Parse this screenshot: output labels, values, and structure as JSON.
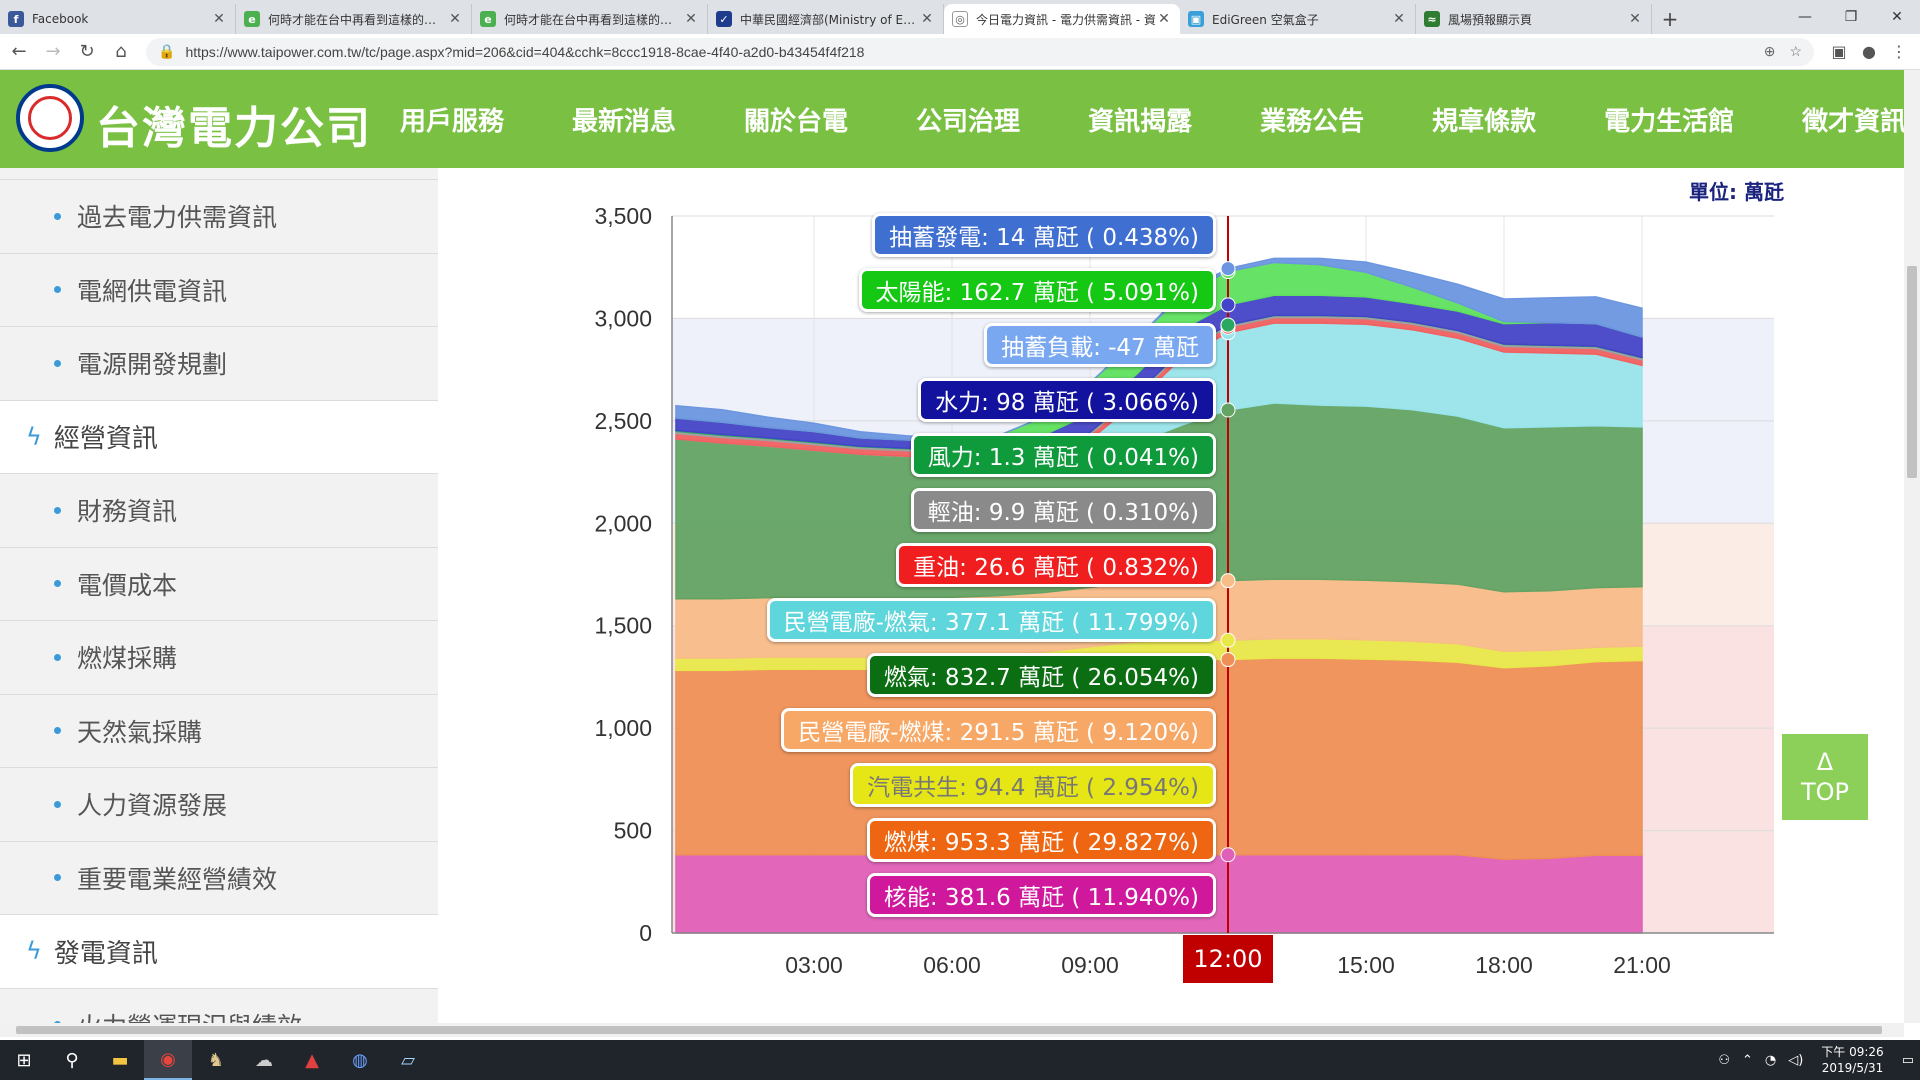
{
  "browser": {
    "tabs": [
      {
        "title": "Facebook",
        "favicon": "facebook-icon",
        "color": "#3b5998",
        "glyph": "f"
      },
      {
        "title": "何時才能在台中再看到這樣的藍天",
        "favicon": "edigreen-icon",
        "color": "#4caf50",
        "glyph": "e"
      },
      {
        "title": "何時才能在台中再看到這樣的藍天",
        "favicon": "edigreen-icon",
        "color": "#4caf50",
        "glyph": "e"
      },
      {
        "title": "中華民國經濟部(Ministry of Econ",
        "favicon": "moea-icon",
        "color": "#1e3c8c",
        "glyph": "✓"
      },
      {
        "title": "今日電力資訊 - 電力供需資訊 - 資",
        "favicon": "taipower-icon",
        "color": "#ffffff",
        "glyph": "◎",
        "active": true
      },
      {
        "title": "EdiGreen 空氣盒子",
        "favicon": "edigreen-air-icon",
        "color": "#3aa0d8",
        "glyph": "▣"
      },
      {
        "title": "風場預報顯示頁",
        "favicon": "wind-icon",
        "color": "#2e7d32",
        "glyph": "≈"
      }
    ],
    "url": "https://www.taipower.com.tw/tc/page.aspx?mid=206&cid=404&cchk=8ccc1918-8cae-4f40-a2d0-b43454f4f218"
  },
  "site": {
    "brand": "台灣電力公司",
    "nav": [
      "用戶服務",
      "最新消息",
      "關於台電",
      "公司治理",
      "資訊揭露",
      "業務公告",
      "規章條款",
      "電力生活館",
      "徵才資訊"
    ]
  },
  "sidebar": {
    "items": [
      {
        "label": "過去電力供需資訊",
        "type": "sub"
      },
      {
        "label": "電網供電資訊",
        "type": "sub"
      },
      {
        "label": "電源開發規劃",
        "type": "sub"
      },
      {
        "label": "經營資訊",
        "type": "cat"
      },
      {
        "label": "財務資訊",
        "type": "sub"
      },
      {
        "label": "電價成本",
        "type": "sub"
      },
      {
        "label": "燃煤採購",
        "type": "sub"
      },
      {
        "label": "天然氣採購",
        "type": "sub"
      },
      {
        "label": "人力資源發展",
        "type": "sub"
      },
      {
        "label": "重要電業經營績效",
        "type": "sub"
      },
      {
        "label": "發電資訊",
        "type": "cat"
      },
      {
        "label": "火力營運現況與績效",
        "type": "sub"
      }
    ]
  },
  "chart_unit": "單位: 萬瓩",
  "time_badge": "12:00",
  "top_button": {
    "arrow": "Δ",
    "label": "TOP"
  },
  "callouts": [
    {
      "text": "抽蓄發電: 14 萬瓩 ( 0.438%)",
      "color": "#3f6fd0"
    },
    {
      "text": "太陽能: 162.7 萬瓩 ( 5.091%)",
      "color": "#14c814"
    },
    {
      "text": "抽蓄負載: -47 萬瓩",
      "color": "#7aa8f0"
    },
    {
      "text": "水力: 98 萬瓩 ( 3.066%)",
      "color": "#12129e"
    },
    {
      "text": "風力: 1.3 萬瓩 ( 0.041%)",
      "color": "#0f9a3c"
    },
    {
      "text": "輕油: 9.9 萬瓩 ( 0.310%)",
      "color": "#8a8a8a"
    },
    {
      "text": "重油: 26.6 萬瓩 ( 0.832%)",
      "color": "#f01e1e"
    },
    {
      "text": "民營電廠-燃氣: 377.1 萬瓩 ( 11.799%)",
      "color": "#5fd6dc"
    },
    {
      "text": "燃氣: 832.7 萬瓩 ( 26.054%)",
      "color": "#0b6e12"
    },
    {
      "text": "民營電廠-燃煤: 291.5 萬瓩 ( 9.120%)",
      "color": "#f7a866"
    },
    {
      "text": "汽電共生: 94.4 萬瓩 ( 2.954%)",
      "color": "#e6e616"
    },
    {
      "text": "燃煤: 953.3 萬瓩 ( 29.827%)",
      "color": "#ee6611"
    },
    {
      "text": "核能: 381.6 萬瓩 ( 11.940%)",
      "color": "#d0189c"
    }
  ],
  "chart_data": {
    "type": "area",
    "ylim": [
      0,
      3500
    ],
    "yticks": [
      "0",
      "500",
      "1,000",
      "1,500",
      "2,000",
      "2,500",
      "3,000",
      "3,500"
    ],
    "xticks": [
      "03:00",
      "06:00",
      "09:00",
      "12:00",
      "15:00",
      "18:00",
      "21:00"
    ],
    "x": [
      "00:00",
      "01:00",
      "02:00",
      "03:00",
      "04:00",
      "05:00",
      "06:00",
      "07:00",
      "08:00",
      "09:00",
      "10:00",
      "11:00",
      "12:00",
      "13:00",
      "14:00",
      "15:00",
      "16:00",
      "17:00",
      "18:00",
      "19:00",
      "20:00",
      "21:00"
    ],
    "series": [
      {
        "name": "核能",
        "color": "#e060b8",
        "values": [
          382,
          382,
          382,
          382,
          382,
          382,
          382,
          382,
          382,
          382,
          382,
          382,
          382,
          382,
          382,
          382,
          382,
          382,
          360,
          365,
          380,
          380
        ]
      },
      {
        "name": "燃煤",
        "color": "#ee9055",
        "values": [
          900,
          900,
          905,
          905,
          905,
          905,
          905,
          910,
          920,
          935,
          950,
          955,
          953,
          960,
          960,
          955,
          950,
          940,
          935,
          940,
          945,
          950
        ]
      },
      {
        "name": "汽電共生",
        "color": "#e8e84a",
        "values": [
          60,
          60,
          60,
          60,
          60,
          60,
          62,
          65,
          70,
          80,
          90,
          92,
          94,
          94,
          94,
          94,
          92,
          90,
          80,
          75,
          70,
          70
        ]
      },
      {
        "name": "民營電廠-燃煤",
        "color": "#f8bc88",
        "values": [
          290,
          290,
          290,
          290,
          290,
          290,
          290,
          290,
          290,
          290,
          290,
          291,
          291,
          291,
          291,
          291,
          291,
          291,
          291,
          291,
          291,
          291
        ]
      },
      {
        "name": "燃氣",
        "color": "#63a363",
        "values": [
          780,
          760,
          740,
          720,
          700,
          690,
          680,
          650,
          650,
          660,
          680,
          760,
          833,
          860,
          850,
          850,
          840,
          820,
          800,
          800,
          790,
          780
        ]
      },
      {
        "name": "民營電廠-燃氣",
        "color": "#98e4ea",
        "values": [
          0,
          0,
          0,
          0,
          0,
          0,
          0,
          0,
          0,
          60,
          200,
          330,
          377,
          390,
          400,
          400,
          390,
          380,
          370,
          360,
          350,
          300
        ]
      },
      {
        "name": "重油",
        "color": "#f06060",
        "values": [
          27,
          27,
          27,
          27,
          27,
          27,
          27,
          27,
          27,
          27,
          27,
          27,
          27,
          27,
          27,
          27,
          27,
          27,
          27,
          27,
          27,
          27
        ]
      },
      {
        "name": "輕油",
        "color": "#a0a0a0",
        "values": [
          10,
          10,
          10,
          10,
          10,
          10,
          10,
          10,
          10,
          10,
          10,
          10,
          10,
          10,
          10,
          10,
          10,
          10,
          10,
          10,
          10,
          10
        ]
      },
      {
        "name": "風力",
        "color": "#2aa860",
        "values": [
          5,
          5,
          4,
          4,
          3,
          3,
          2,
          2,
          2,
          1,
          1,
          1,
          1,
          1,
          1,
          1,
          1,
          1,
          2,
          2,
          2,
          2
        ]
      },
      {
        "name": "水力",
        "color": "#4444c8",
        "values": [
          60,
          60,
          50,
          50,
          40,
          40,
          40,
          60,
          80,
          90,
          95,
          98,
          98,
          98,
          98,
          95,
          90,
          95,
          100,
          110,
          110,
          100
        ]
      },
      {
        "name": "太陽能",
        "color": "#5ee05e",
        "values": [
          0,
          0,
          0,
          0,
          0,
          0,
          5,
          30,
          90,
          150,
          170,
          170,
          163,
          160,
          150,
          120,
          80,
          40,
          10,
          0,
          0,
          0
        ]
      },
      {
        "name": "抽蓄發電",
        "color": "#6c96e0",
        "values": [
          60,
          60,
          50,
          40,
          30,
          20,
          10,
          0,
          0,
          0,
          0,
          10,
          14,
          20,
          30,
          50,
          70,
          90,
          110,
          120,
          130,
          140
        ]
      }
    ]
  }
}
